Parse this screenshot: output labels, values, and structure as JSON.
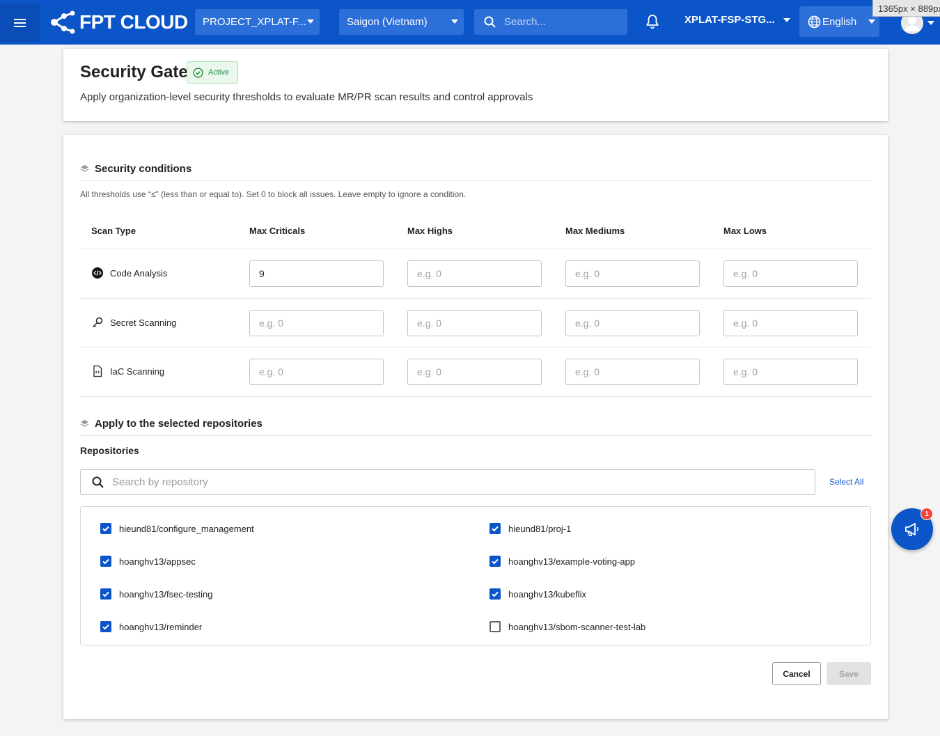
{
  "topbar": {
    "logo_text": "FPT CLOUD",
    "project": "PROJECT_XPLAT-F...",
    "region": "Saigon (Vietnam)",
    "search_placeholder": "Search...",
    "tenant": "XPLAT-FSP-STG...",
    "language": "English",
    "viewport_badge": "1365px × 889px",
    "brand_color": "#0b55c8"
  },
  "header": {
    "title": "Security Gate",
    "status": "Active",
    "subtitle": "Apply organization-level security thresholds to evaluate MR/PR scan results and control approvals"
  },
  "conditions": {
    "title": "Security conditions",
    "hint": "All thresholds use “≤” (less than or equal to). Set 0 to block all issues. Leave empty to ignore a condition.",
    "columns": [
      "Scan Type",
      "Max Criticals",
      "Max Highs",
      "Max Mediums",
      "Max Lows"
    ],
    "placeholder": "e.g. 0",
    "rows": [
      {
        "label": "Code Analysis",
        "icon": "code-icon",
        "values": [
          "9",
          "",
          "",
          ""
        ]
      },
      {
        "label": "Secret Scanning",
        "icon": "key-icon",
        "values": [
          "",
          "",
          "",
          ""
        ]
      },
      {
        "label": "IaC Scanning",
        "icon": "code-file-icon",
        "values": [
          "",
          "",
          "",
          ""
        ]
      }
    ]
  },
  "repositories": {
    "section_title": "Apply to the selected repositories",
    "label": "Repositories",
    "search_placeholder": "Search by repository",
    "select_all": "Select All",
    "items": [
      {
        "name": "hieund81/configure_management",
        "checked": true
      },
      {
        "name": "hieund81/proj-1",
        "checked": true
      },
      {
        "name": "hoanghv13/appsec",
        "checked": true
      },
      {
        "name": "hoanghv13/example-voting-app",
        "checked": true
      },
      {
        "name": "hoanghv13/fsec-testing",
        "checked": true
      },
      {
        "name": "hoanghv13/kubeflix",
        "checked": true
      },
      {
        "name": "hoanghv13/reminder",
        "checked": true
      },
      {
        "name": "hoanghv13/sbom-scanner-test-lab",
        "checked": false
      }
    ]
  },
  "actions": {
    "cancel": "Cancel",
    "save": "Save"
  },
  "fab": {
    "badge": "1"
  }
}
